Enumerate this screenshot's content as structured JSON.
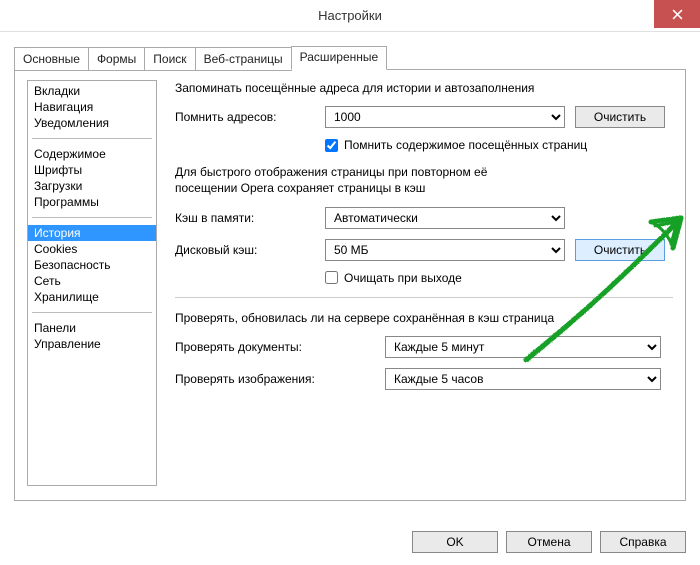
{
  "window": {
    "title": "Настройки"
  },
  "tabs": [
    "Основные",
    "Формы",
    "Поиск",
    "Веб-страницы",
    "Расширенные"
  ],
  "active_tab": 4,
  "sidebar": {
    "groups": [
      [
        "Вкладки",
        "Навигация",
        "Уведомления"
      ],
      [
        "Содержимое",
        "Шрифты",
        "Загрузки",
        "Программы"
      ],
      [
        "История",
        "Cookies",
        "Безопасность",
        "Сеть",
        "Хранилище"
      ],
      [
        "Панели",
        "Управление"
      ]
    ],
    "selected": "История"
  },
  "content": {
    "hist_desc": "Запоминать посещённые адреса для истории и автозаполнения",
    "address_label": "Помнить адресов:",
    "address_value": "1000",
    "clear_label": "Очистить",
    "remember_content_label": "Помнить содержимое посещённых страниц",
    "remember_content_checked": true,
    "cache_desc1": "Для быстрого отображения страницы при повторном её",
    "cache_desc2": "посещении Opera сохраняет страницы в кэш",
    "mem_label": "Кэш в памяти:",
    "mem_value": "Автоматически",
    "disk_label": "Дисковый кэш:",
    "disk_value": "50 МБ",
    "clear_on_exit_label": "Очищать при выходе",
    "clear_on_exit_checked": false,
    "check_desc": "Проверять, обновилась ли на сервере сохранённая в кэш страница",
    "check_docs_label": "Проверять документы:",
    "check_docs_value": "Каждые 5 минут",
    "check_imgs_label": "Проверять изображения:",
    "check_imgs_value": "Каждые 5 часов"
  },
  "footer": {
    "ok": "OK",
    "cancel": "Отмена",
    "help": "Справка"
  }
}
